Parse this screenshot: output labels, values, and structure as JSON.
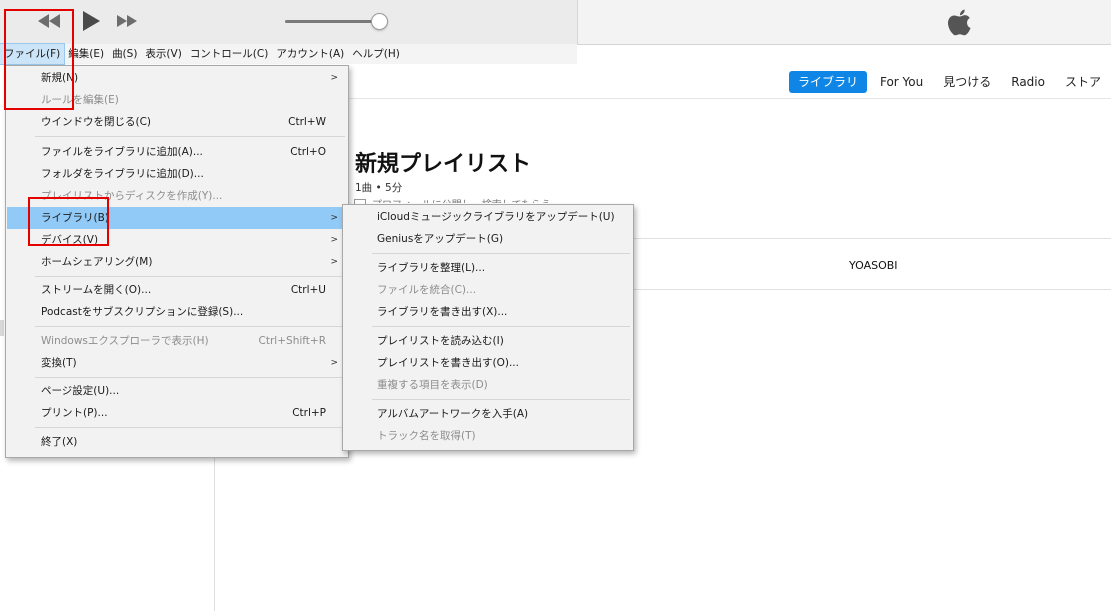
{
  "player": {
    "volume": 0.9
  },
  "menubar": [
    {
      "label": "ファイル(F)",
      "active": true
    },
    {
      "label": "編集(E)"
    },
    {
      "label": "曲(S)"
    },
    {
      "label": "表示(V)"
    },
    {
      "label": "コントロール(C)"
    },
    {
      "label": "アカウント(A)"
    },
    {
      "label": "ヘルプ(H)"
    }
  ],
  "nav_tabs": [
    "ライブラリ",
    "For You",
    "見つける",
    "Radio",
    "ストア"
  ],
  "playlist": {
    "title": "新規プレイリスト",
    "meta": "1曲 • 5分",
    "partial_text": "プロフィールに公開し、検索してもらう",
    "artist": "YOASOBI"
  },
  "file_menu": [
    {
      "label": "新規(N)",
      "submenu": true
    },
    {
      "label": "ルールを編集(E)",
      "disabled": true
    },
    {
      "label": "ウインドウを閉じる(C)",
      "shortcut": "Ctrl+W"
    },
    {
      "separator": true
    },
    {
      "label": "ファイルをライブラリに追加(A)...",
      "shortcut": "Ctrl+O"
    },
    {
      "label": "フォルダをライブラリに追加(D)..."
    },
    {
      "label": "プレイリストからディスクを作成(Y)...",
      "disabled": true
    },
    {
      "label": "ライブラリ(B)",
      "submenu": true,
      "highlighted": true
    },
    {
      "label": "デバイス(V)",
      "submenu": true
    },
    {
      "label": "ホームシェアリング(M)",
      "submenu": true
    },
    {
      "separator": true
    },
    {
      "label": "ストリームを開く(O)...",
      "shortcut": "Ctrl+U"
    },
    {
      "label": "Podcastをサブスクリプションに登録(S)..."
    },
    {
      "separator": true
    },
    {
      "label": "Windowsエクスプローラで表示(H)",
      "shortcut": "Ctrl+Shift+R",
      "disabled": true
    },
    {
      "label": "変換(T)",
      "submenu": true
    },
    {
      "separator": true
    },
    {
      "label": "ページ設定(U)..."
    },
    {
      "label": "プリント(P)...",
      "shortcut": "Ctrl+P"
    },
    {
      "separator": true
    },
    {
      "label": "終了(X)"
    }
  ],
  "library_menu": [
    {
      "label": "iCloudミュージックライブラリをアップデート(U)"
    },
    {
      "label": "Geniusをアップデート(G)"
    },
    {
      "separator": true
    },
    {
      "label": "ライブラリを整理(L)..."
    },
    {
      "label": "ファイルを統合(C)...",
      "disabled": true
    },
    {
      "label": "ライブラリを書き出す(X)..."
    },
    {
      "separator": true
    },
    {
      "label": "プレイリストを読み込む(I)"
    },
    {
      "label": "プレイリストを書き出す(O)..."
    },
    {
      "label": "重複する項目を表示(D)",
      "disabled": true
    },
    {
      "separator": true
    },
    {
      "label": "アルバムアートワークを入手(A)"
    },
    {
      "label": "トラック名を取得(T)",
      "disabled": true
    }
  ],
  "colors": {
    "accent": "#0f86e6",
    "menu_highlight": "#91c9f7",
    "annotation": "#e50000"
  },
  "icons": [
    "rewind-icon",
    "play-icon",
    "fast-forward-icon",
    "volume-slider",
    "apple-logo-icon",
    "submenu-arrow-icon"
  ]
}
